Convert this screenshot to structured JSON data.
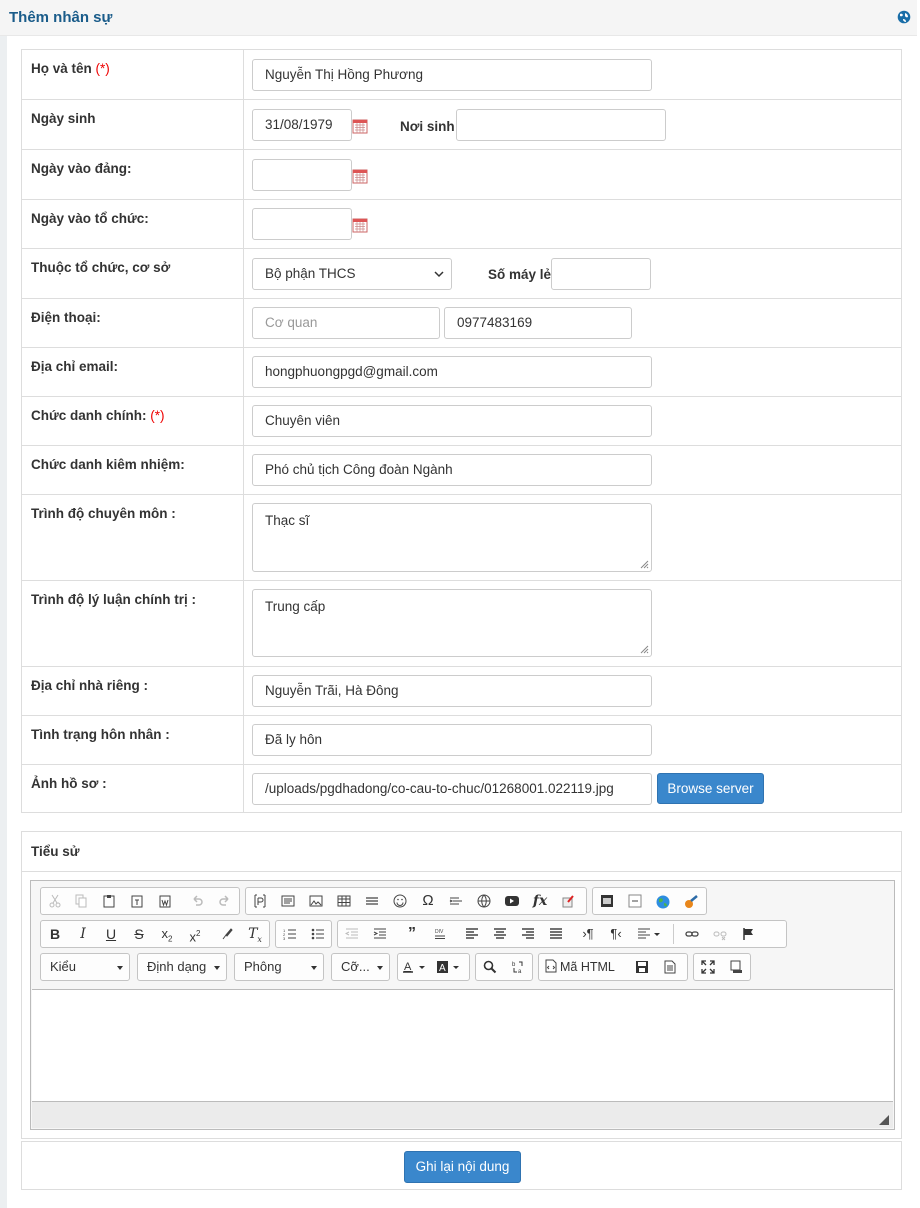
{
  "panel": {
    "title": "Thêm nhân sự"
  },
  "form": {
    "required_mark": "(*)",
    "full_name": {
      "label": "Họ và tên",
      "value": "Nguyễn Thị Hồng Phương"
    },
    "dob": {
      "label": "Ngày sinh",
      "value": "31/08/1979"
    },
    "birthplace": {
      "label": "Nơi sinh",
      "value": ""
    },
    "party_date": {
      "label": "Ngày vào đảng:",
      "value": ""
    },
    "org_date": {
      "label": "Ngày vào tổ chức:",
      "value": ""
    },
    "org": {
      "label": "Thuộc tổ chức, cơ sở",
      "value": "Bộ phận THCS"
    },
    "ext": {
      "label": "Số máy lẻ",
      "value": ""
    },
    "phone": {
      "label": "Điện thoại:",
      "office_placeholder": "Cơ quan",
      "mobile": "0977483169"
    },
    "email": {
      "label": "Địa chỉ email:",
      "value": "hongphuongpgd@gmail.com"
    },
    "main_title": {
      "label": "Chức danh chính:",
      "value": "Chuyên viên"
    },
    "concurrent_title": {
      "label": "Chức danh kiêm nhiệm:",
      "value": "Phó chủ tịch Công đoàn Ngành"
    },
    "expertise": {
      "label": "Trình độ chuyên môn :",
      "value": "Thạc sĩ"
    },
    "political": {
      "label": "Trình độ lý luận chính trị :",
      "value": "Trung cấp"
    },
    "address": {
      "label": "Địa chỉ nhà riêng :",
      "value": "Nguyễn Trãi, Hà Đông"
    },
    "marital": {
      "label": "Tình trạng hôn nhân :",
      "value": "Đã ly hôn"
    },
    "photo": {
      "label": "Ảnh hồ sơ :",
      "value": "/uploads/pgdhadong/co-cau-to-chuc/01268001.022119.jpg",
      "browse_label": "Browse server"
    }
  },
  "bio": {
    "label": "Tiểu sử",
    "combos": {
      "style": "Kiểu",
      "format": "Định dạng",
      "font": "Phông",
      "size": "Cỡ..."
    },
    "source_label": "Mã HTML"
  },
  "submit_label": "Ghi lại nội dung",
  "colors": {
    "title": "#1a5c8a",
    "primary_button": "#3a87cc",
    "required": "#e00000"
  }
}
